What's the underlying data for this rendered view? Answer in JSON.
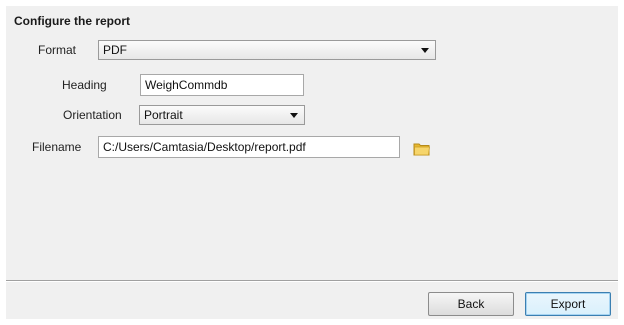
{
  "dialog": {
    "title": "Configure the report"
  },
  "form": {
    "format": {
      "label": "Format",
      "value": "PDF"
    },
    "heading": {
      "label": "Heading",
      "value": "WeighCommdb"
    },
    "orientation": {
      "label": "Orientation",
      "value": "Portrait"
    },
    "filename": {
      "label": "Filename",
      "value": "C:/Users/Camtasia/Desktop/report.pdf",
      "browse_icon": "folder-icon"
    }
  },
  "buttons": {
    "back_label": "Back",
    "export_label": "Export"
  },
  "colors": {
    "dialog_background": "#f0f0f0",
    "folder_icon": "#f2c94c",
    "default_button_border": "#3c7fb1"
  }
}
